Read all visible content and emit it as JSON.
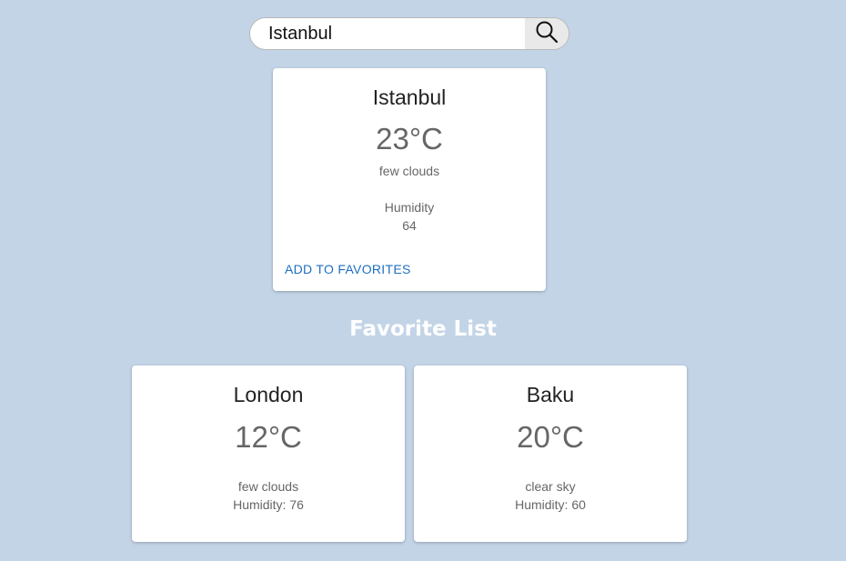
{
  "search": {
    "value": "Istanbul",
    "icon": "search-icon"
  },
  "current": {
    "city": "Istanbul",
    "temperature": "23°C",
    "description": "few clouds",
    "humidity_label": "Humidity",
    "humidity_value": "64",
    "add_button": "ADD TO FAVORITES"
  },
  "favorites": {
    "title": "Favorite List",
    "items": [
      {
        "city": "London",
        "temperature": "12°C",
        "description": "few clouds",
        "humidity": "Humidity: 76"
      },
      {
        "city": "Baku",
        "temperature": "20°C",
        "description": "clear sky",
        "humidity": "Humidity: 60"
      }
    ]
  },
  "colors": {
    "background": "#c3d4e7",
    "accent": "#1e6fc1",
    "card": "#ffffff"
  }
}
